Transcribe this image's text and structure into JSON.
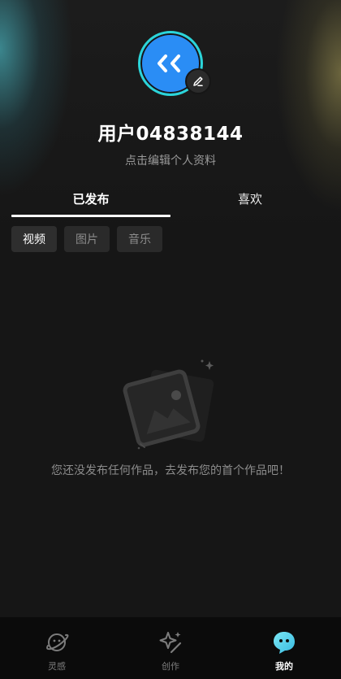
{
  "profile": {
    "username": "用户04838144",
    "subtitle": "点击编辑个人资料"
  },
  "tabs": [
    {
      "label": "已发布",
      "active": true
    },
    {
      "label": "喜欢",
      "active": false
    }
  ],
  "filters": [
    {
      "label": "视频",
      "active": true
    },
    {
      "label": "图片",
      "active": false
    },
    {
      "label": "音乐",
      "active": false
    }
  ],
  "empty_state": {
    "message": "您还没发布任何作品，去发布您的首个作品吧！",
    "icon": "image-placeholder-icon"
  },
  "bottom_nav": [
    {
      "label": "灵感",
      "icon": "planet-icon",
      "active": false
    },
    {
      "label": "创作",
      "icon": "sparkle-wand-icon",
      "active": false
    },
    {
      "label": "我的",
      "icon": "chat-bubble-icon",
      "active": true
    }
  ],
  "colors": {
    "background": "#161616",
    "avatar_fill": "#2a8df5",
    "avatar_ring": "#2bd5d9",
    "nav_active": "#5fd4ee"
  }
}
